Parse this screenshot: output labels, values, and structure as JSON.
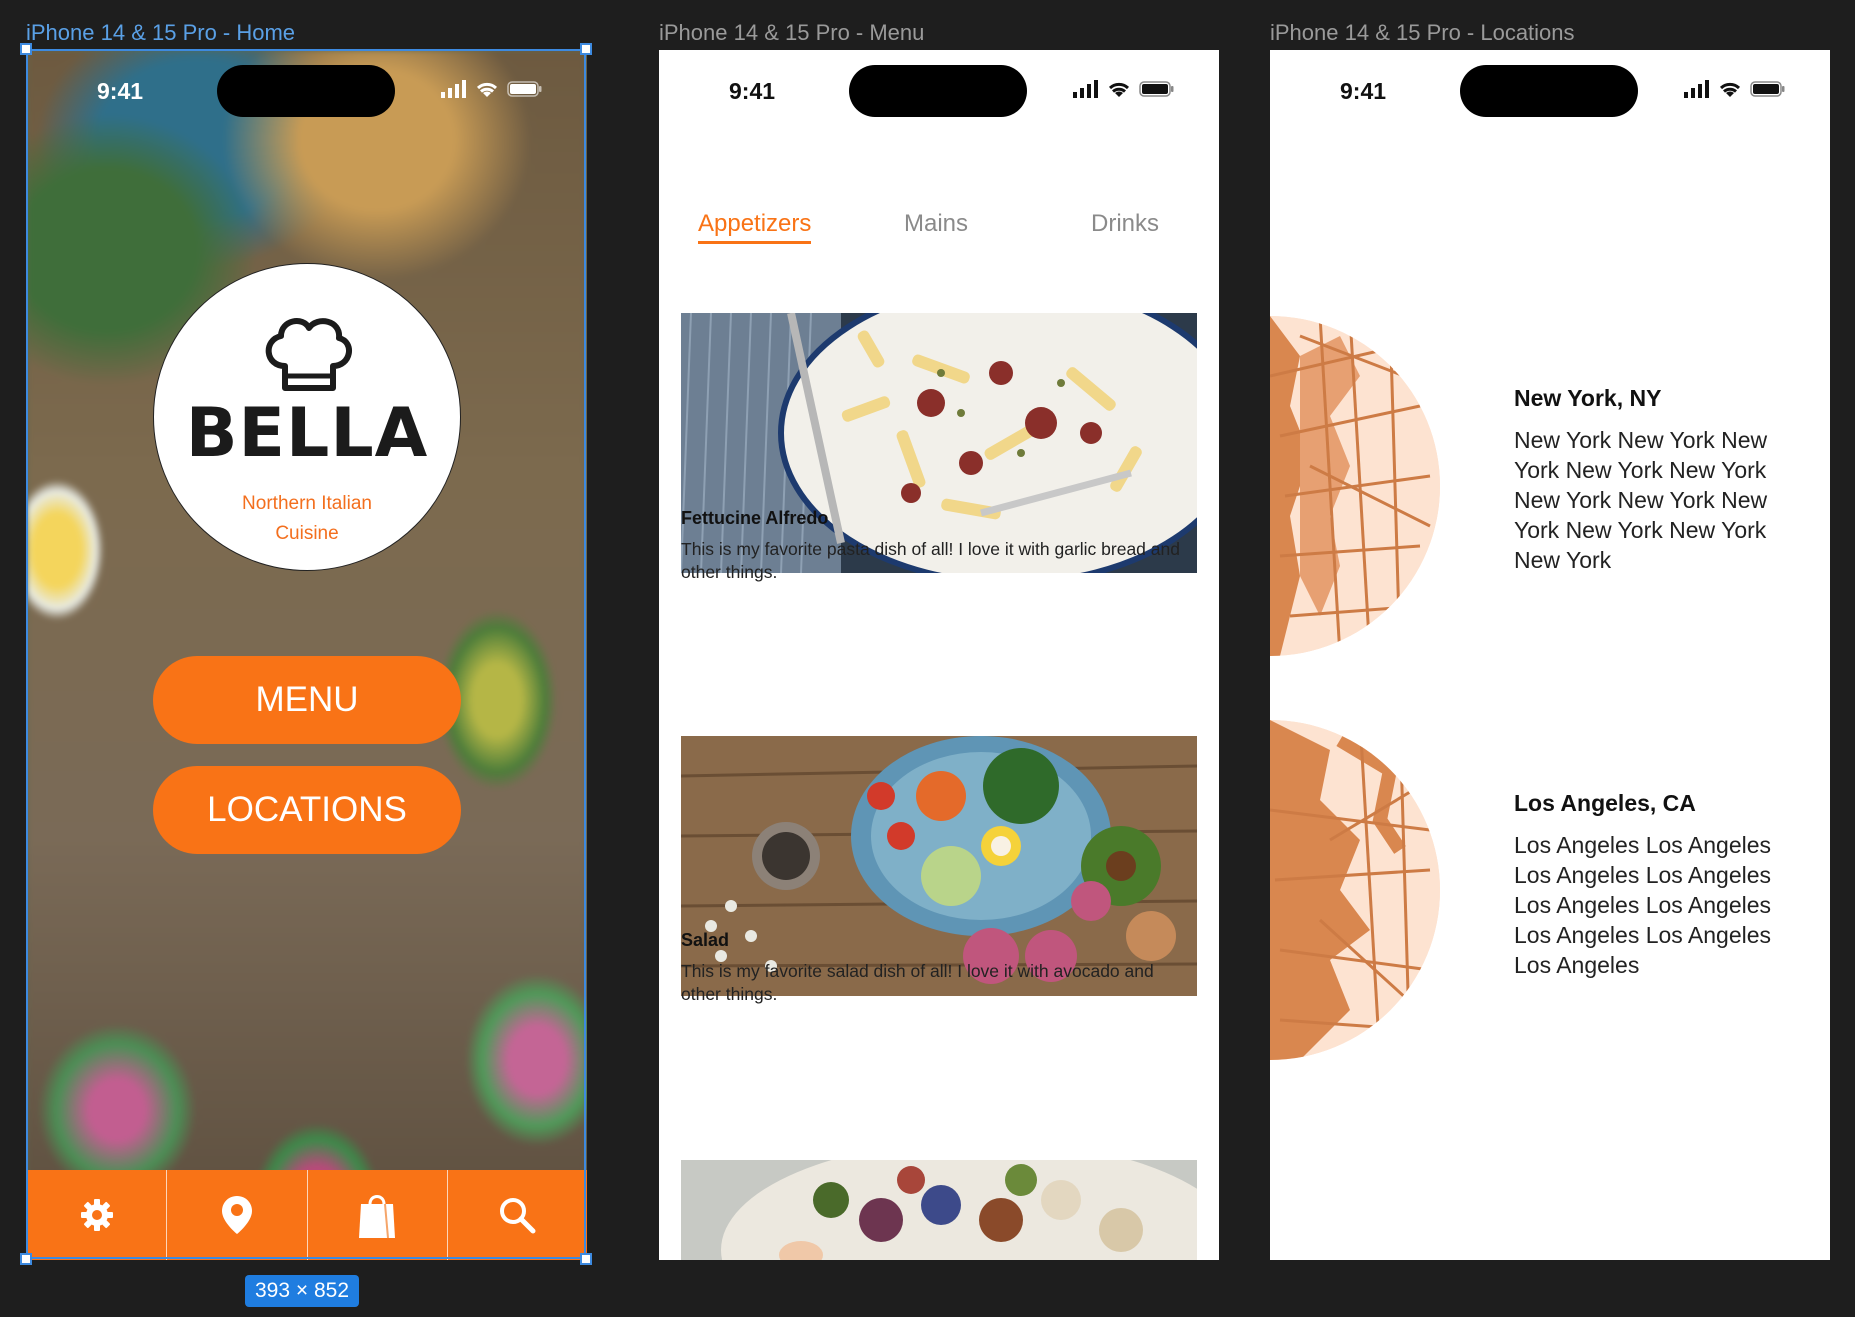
{
  "frames": {
    "home": {
      "label": "iPhone 14 & 15 Pro - Home"
    },
    "menu": {
      "label": "iPhone 14 & 15 Pro - Menu"
    },
    "locations": {
      "label": "iPhone 14 & 15 Pro - Locations"
    }
  },
  "selection": {
    "size_badge": "393 × 852"
  },
  "status_bar": {
    "time": "9:41"
  },
  "home": {
    "brand": "BELLA",
    "tagline_line1": "Northern Italian",
    "tagline_line2": "Cuisine",
    "menu_button": "MENU",
    "locations_button": "LOCATIONS",
    "tabbar_icons": [
      "gear-icon",
      "location-pin-icon",
      "shopping-bag-icon",
      "search-icon"
    ]
  },
  "menu": {
    "tabs": [
      "Appetizers",
      "Mains",
      "Drinks"
    ],
    "active_tab": "Appetizers",
    "dishes": [
      {
        "title": "Fettucine Alfredo",
        "description": "This is my favorite pasta dish of all! I love it with garlic bread and other things."
      },
      {
        "title": "Salad",
        "description": "This is my favorite salad dish of all! I love it with avocado and other things."
      }
    ]
  },
  "locations": {
    "items": [
      {
        "title": "New York, NY",
        "description": "New York New York New York New York New York New York New York New York New York New York New York"
      },
      {
        "title": "Los Angeles, CA",
        "description": "Los Angeles Los Angeles Los Angeles Los Angeles Los Angeles Los Angeles Los Angeles Los Angeles Los Angeles"
      }
    ]
  },
  "colors": {
    "accent": "#f97316",
    "selection": "#3d8ae0",
    "canvas": "#1e1e1e",
    "map_bg": "#fde3d1",
    "map_roads": "#d9874f"
  }
}
